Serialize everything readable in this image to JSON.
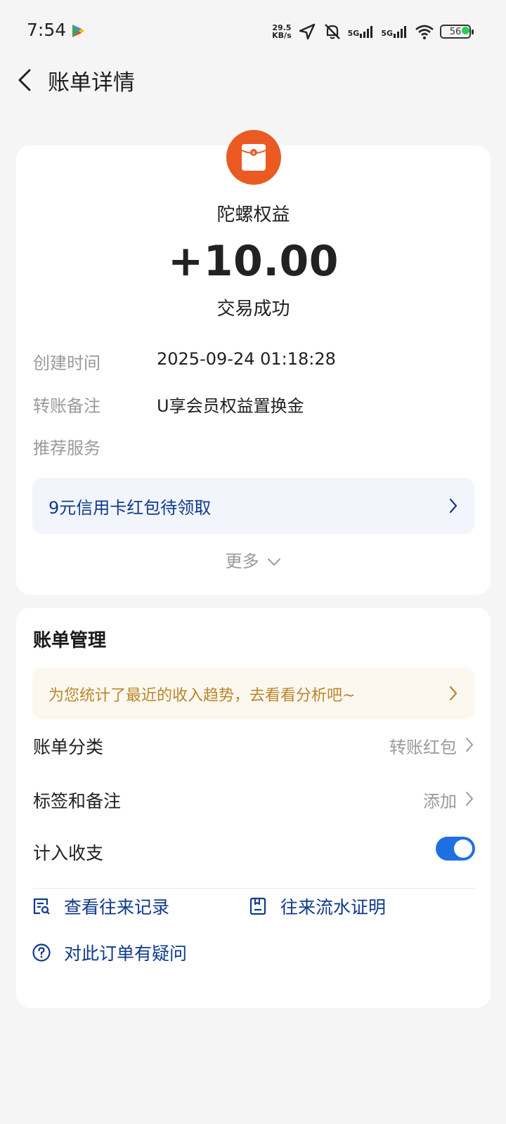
{
  "status_bar": {
    "time": "7:54",
    "net_speed_value": "29.5",
    "net_speed_unit": "KB/s",
    "signal1": "5G",
    "signal2": "5G",
    "battery": "56"
  },
  "header": {
    "title": "账单详情"
  },
  "transaction": {
    "payer": "陀螺权益",
    "amount": "+10.00",
    "status": "交易成功",
    "details": [
      {
        "label": "创建时间",
        "value": "2025-09-24 01:18:28"
      },
      {
        "label": "转账备注",
        "value": "U享会员权益置换金"
      }
    ],
    "recommend_label": "推荐服务",
    "promo_text": "9元信用卡红包待领取",
    "more_label": "更多"
  },
  "management": {
    "title": "账单管理",
    "tip": "为您统计了最近的收入趋势，去看看分析吧~",
    "category_label": "账单分类",
    "category_value": "转账红包",
    "tags_label": "标签和备注",
    "tags_value": "添加",
    "include_label": "计入收支",
    "include_on": true,
    "links": {
      "records": "查看往来记录",
      "proof": "往来流水证明",
      "question": "对此订单有疑问"
    }
  },
  "colors": {
    "accent_blue": "#0f3a8c",
    "toggle_blue": "#1f6fe3",
    "logo_orange": "#ea5a22",
    "tip_text": "#b8862b"
  }
}
